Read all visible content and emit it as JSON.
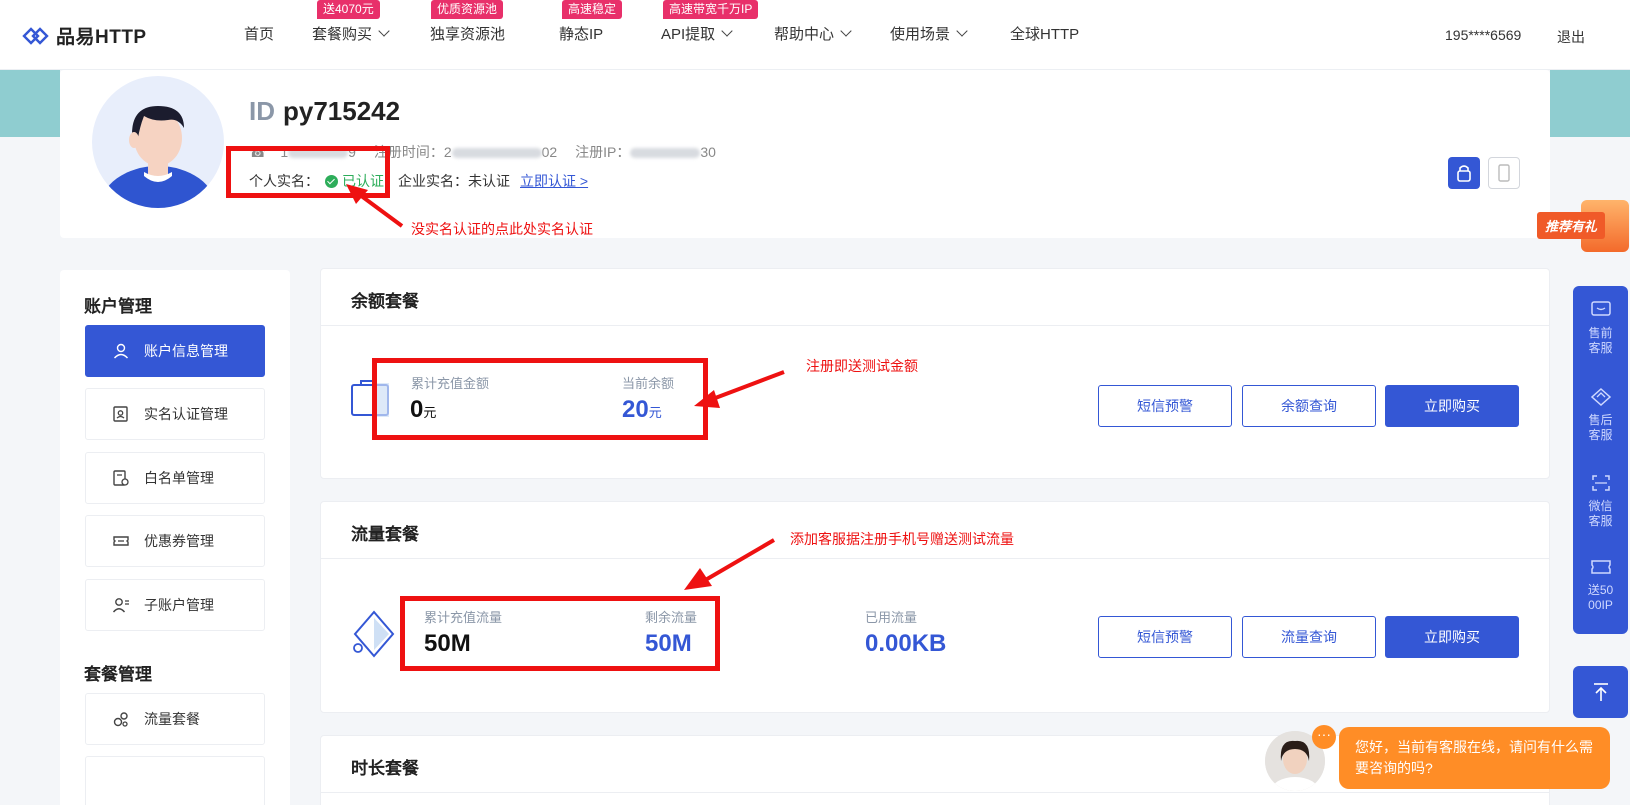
{
  "nav": {
    "logo_text": "品易HTTP",
    "items": [
      {
        "label": "首页"
      },
      {
        "label": "套餐购买",
        "badge": "送4070元"
      },
      {
        "label": "独享资源池",
        "badge": "优质资源池"
      },
      {
        "label": "静态IP",
        "badge": "高速稳定"
      },
      {
        "label": "API提取",
        "badge": "高速带宽千万IP"
      },
      {
        "label": "帮助中心"
      },
      {
        "label": "使用场景"
      },
      {
        "label": "全球HTTP"
      }
    ],
    "user_phone": "195****6569",
    "logout": "退出"
  },
  "profile": {
    "id_label": "ID",
    "id_value": "py715242",
    "meta_a": "1",
    "meta_a_end": "9",
    "reg_time_label": "注册时间：",
    "reg_time_start": "2",
    "reg_time_end": "02",
    "reg_ip_label": "注册IP：",
    "reg_ip_end": "30",
    "personal_label": "个人实名：",
    "personal_status": "已认证",
    "company_label": "企业实名：",
    "company_status": "未认证",
    "verify_link": "立即认证 >"
  },
  "annotations": {
    "realname": "没实名认证的点此处实名认证",
    "balance": "注册即送测试金额",
    "traffic": "添加客服据注册手机号赠送测试流量"
  },
  "sidebar": {
    "account_title": "账户管理",
    "items": [
      {
        "label": "账户信息管理",
        "icon": "user-icon"
      },
      {
        "label": "实名认证管理",
        "icon": "id-card-icon"
      },
      {
        "label": "白名单管理",
        "icon": "whitelist-icon"
      },
      {
        "label": "优惠券管理",
        "icon": "coupon-icon"
      },
      {
        "label": "子账户管理",
        "icon": "sub-account-icon"
      }
    ],
    "package_title": "套餐管理",
    "package_items": [
      {
        "label": "流量套餐",
        "icon": "traffic-icon"
      }
    ]
  },
  "balance_panel": {
    "title": "余额套餐",
    "total_label": "累计充值金额",
    "total_value": "0",
    "total_unit": "元",
    "current_label": "当前余额",
    "current_value": "20",
    "current_unit": "元",
    "btn_sms": "短信预警",
    "btn_query": "余额查询",
    "btn_buy": "立即购买"
  },
  "traffic_panel": {
    "title": "流量套餐",
    "total_label": "累计充值流量",
    "total_value": "50M",
    "remain_label": "剩余流量",
    "remain_value": "50M",
    "used_label": "已用流量",
    "used_value": "0.00KB",
    "btn_sms": "短信预警",
    "btn_query": "流量查询",
    "btn_buy": "立即购买"
  },
  "duration_panel": {
    "title": "时长套餐"
  },
  "float_bar": {
    "promo": "推荐有礼",
    "items": [
      {
        "label": "售前客服",
        "icon": "chat-icon"
      },
      {
        "label": "售后客服",
        "icon": "diamond-icon"
      },
      {
        "label": "微信客服",
        "icon": "scan-icon"
      },
      {
        "label": "送5000IP",
        "icon": "ticket-icon"
      }
    ]
  },
  "chat": {
    "message": "您好，当前有客服在线，请问有什么需要咨询的吗?"
  },
  "colors": {
    "primary": "#3457d5",
    "annotation": "#ee1111",
    "success": "#2dad5a",
    "badge": "#e8306a",
    "chat": "#ff8d26"
  }
}
